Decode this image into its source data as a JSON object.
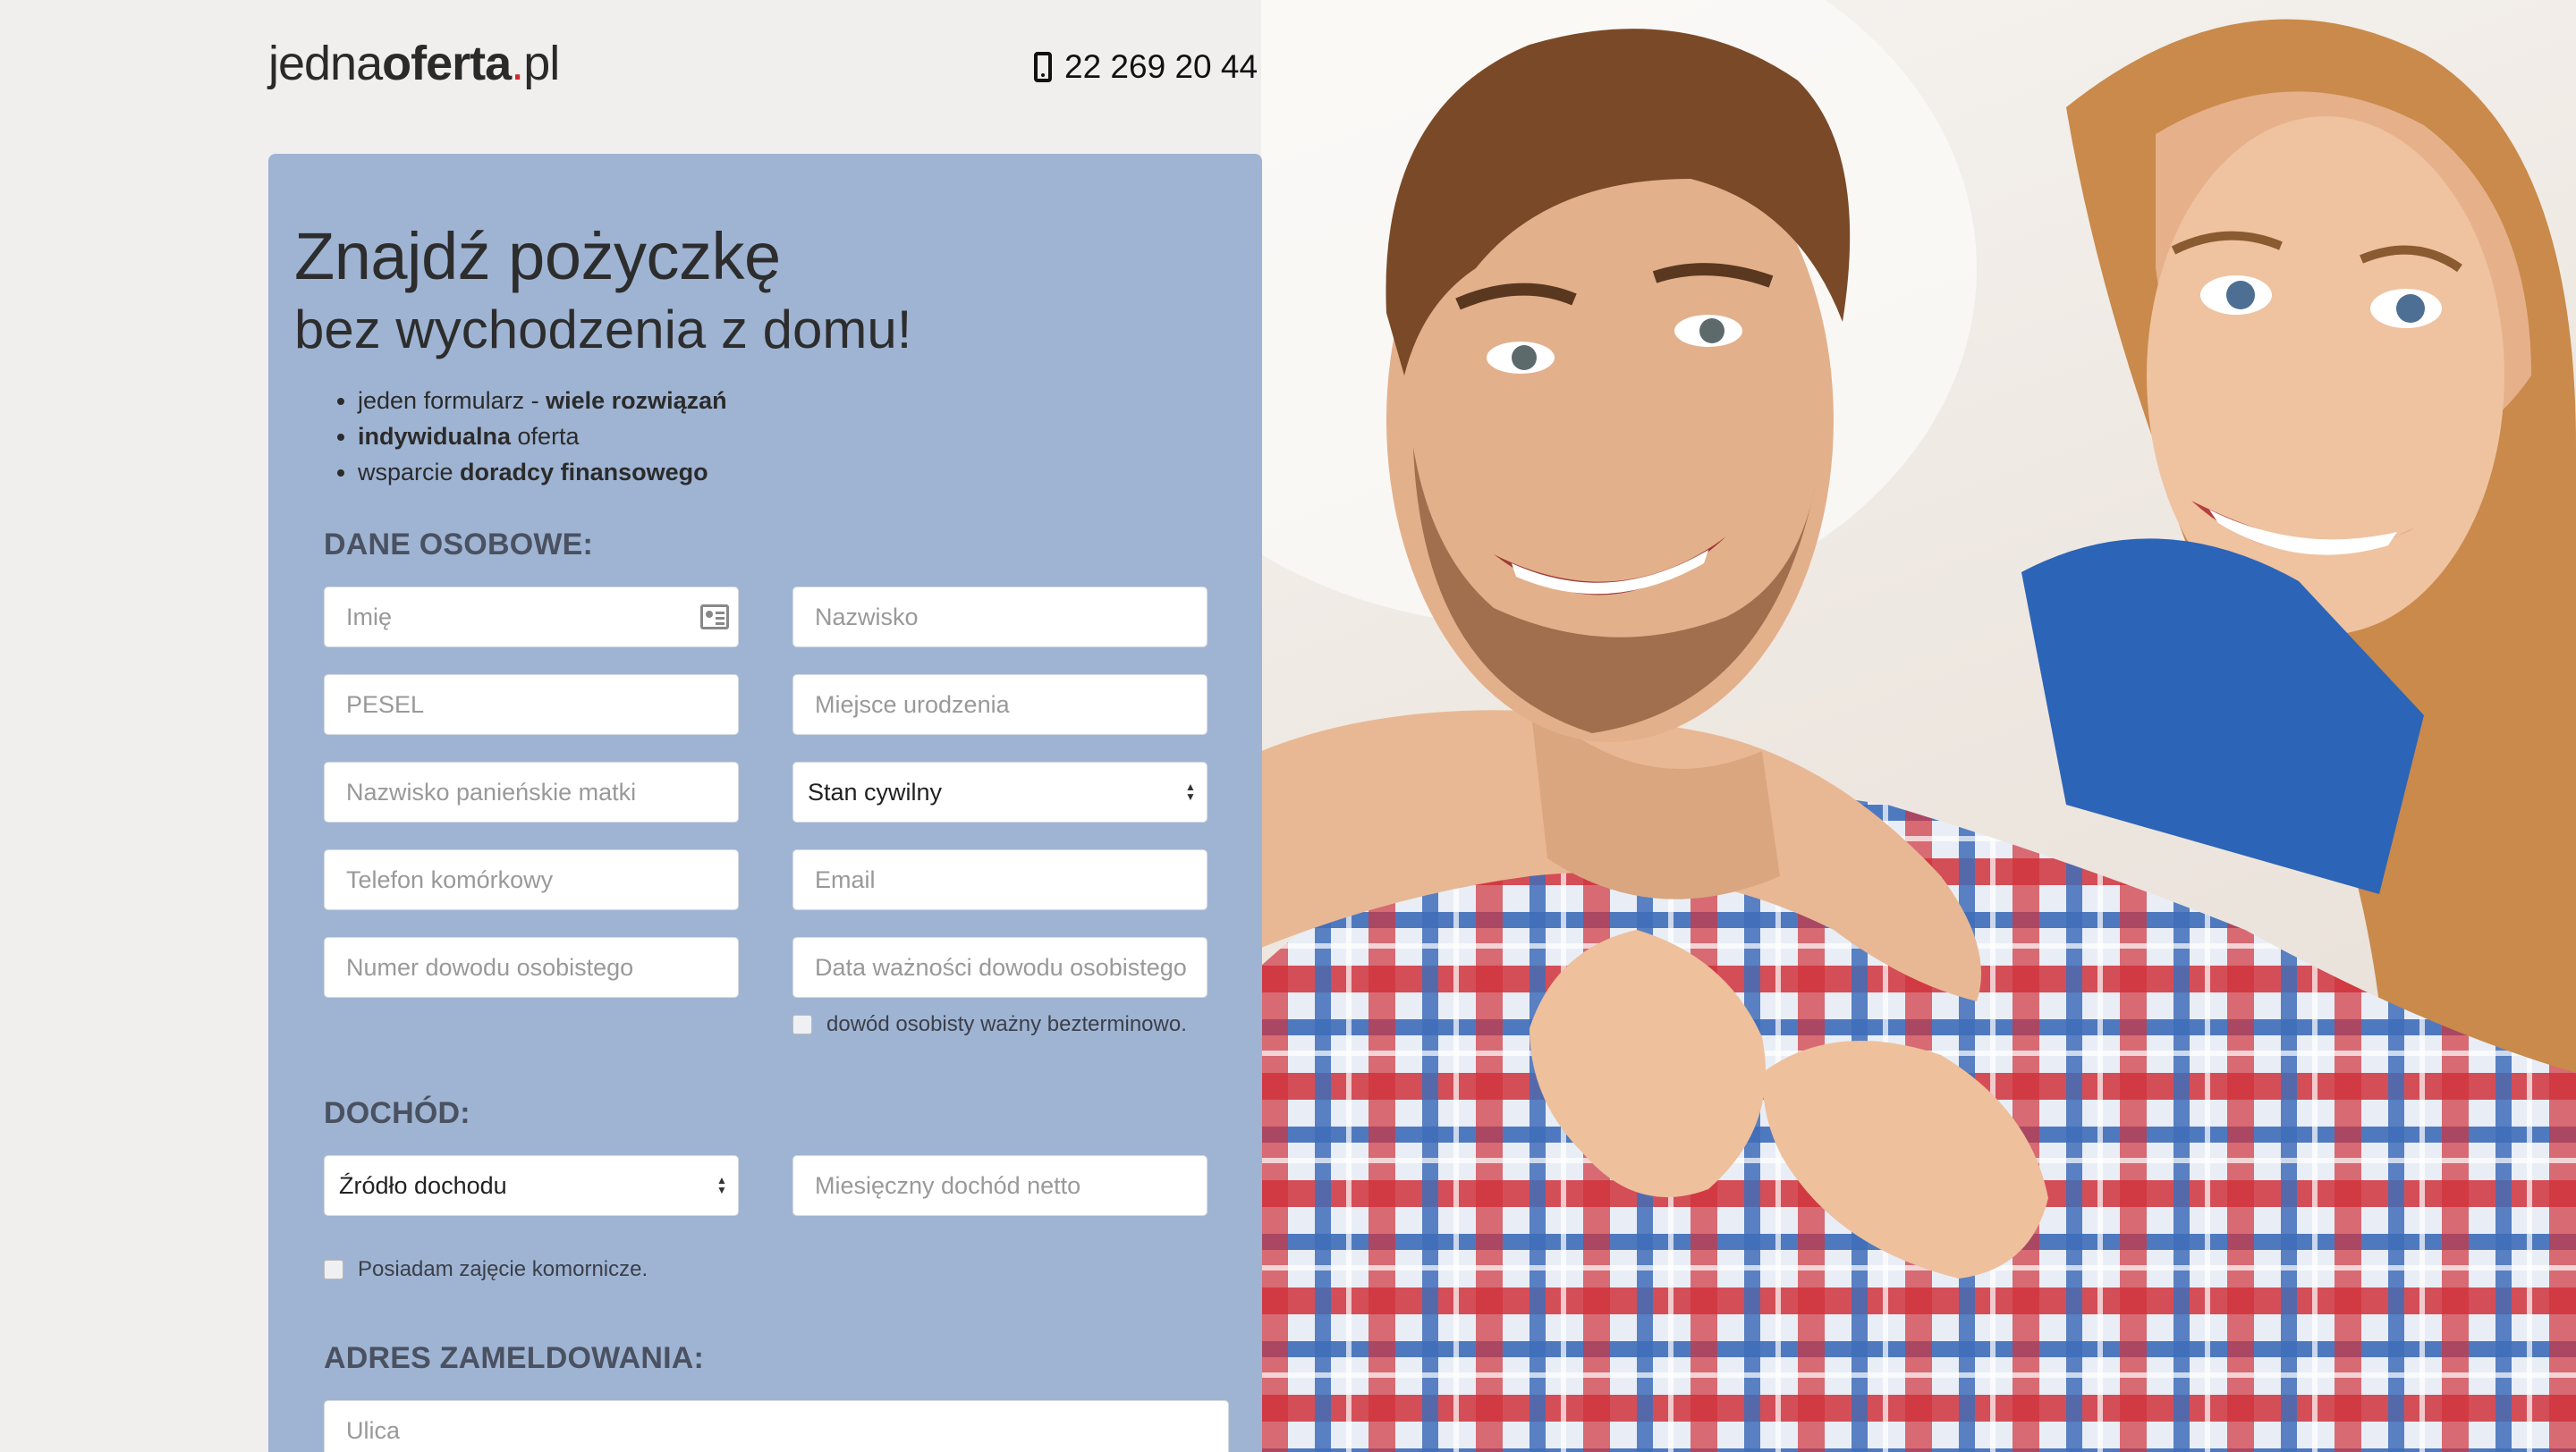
{
  "header": {
    "logo_part1": "jedna",
    "logo_part2": "oferta",
    "logo_dot": ".",
    "logo_tld": "pl",
    "phone_number": "22 269 20 44",
    "phone_icon": "mobile-phone-icon"
  },
  "hero": {
    "title": "Znajdź pożyczkę",
    "subtitle": "bez wychodzenia z domu!",
    "bullets": [
      {
        "normal_before": "jeden formularz - ",
        "bold": "wiele rozwiązań",
        "normal_after": ""
      },
      {
        "normal_before": "",
        "bold": "indywidualna",
        "normal_after": " oferta"
      },
      {
        "normal_before": "wsparcie ",
        "bold": "doradcy finansowego",
        "normal_after": ""
      }
    ]
  },
  "sections": {
    "personal": "DANE OSOBOWE:",
    "income": "DOCHÓD:",
    "address": "ADRES ZAMELDOWANIA:"
  },
  "personal_fields": {
    "first_name": "Imię",
    "last_name": "Nazwisko",
    "pesel": "PESEL",
    "birth_place": "Miejsce urodzenia",
    "mother_maiden_name": "Nazwisko panieńskie matki",
    "marital_status": "Stan cywilny",
    "mobile_phone": "Telefon komórkowy",
    "email": "Email",
    "id_number": "Numer dowodu osobistego",
    "id_expiry": "Data ważności dowodu osobistego",
    "id_indefinite_label": "dowód osobisty ważny bezterminowo."
  },
  "income_fields": {
    "income_source": "Źródło dochodu",
    "monthly_net": "Miesięczny dochód netto",
    "bailiff_label": "Posiadam zajęcie komornicze."
  },
  "address_fields": {
    "street": "Ulica"
  },
  "colors": {
    "page_bg": "#f0efee",
    "card_bg": "#9fb4d3",
    "logo_dot": "#d0262c",
    "section_heading": "#4a5160"
  }
}
